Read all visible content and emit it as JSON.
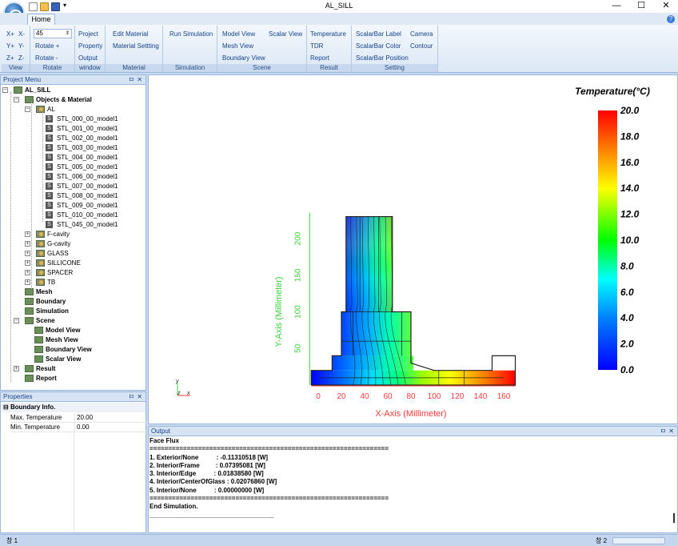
{
  "window": {
    "title": "AL_SILL",
    "minimize": "—",
    "maximize": "☐",
    "close": "✕"
  },
  "ribbon": {
    "tab": "Home",
    "view": {
      "label": "View",
      "buttons": [
        "X+",
        "X-",
        "Y+",
        "Y-",
        "Z+",
        "Z-"
      ]
    },
    "rotate": {
      "label": "Rotate",
      "value": "45",
      "plus": "Rotate +",
      "minus": "Rotate -"
    },
    "window": {
      "label": "window",
      "buttons": [
        "Project",
        "Property",
        "Output"
      ]
    },
    "material": {
      "label": "Material",
      "buttons": [
        "Edit Material",
        "Material Settting"
      ]
    },
    "simulation": {
      "label": "Simulation",
      "buttons": [
        "Run Simulation"
      ]
    },
    "scene": {
      "label": "Scene",
      "buttons": [
        "Model View",
        "Scalar View",
        "Mesh View",
        "Boundary View"
      ]
    },
    "result": {
      "label": "Result",
      "buttons": [
        "Temperature",
        "TDR",
        "Report"
      ]
    },
    "setting": {
      "label": "Setting",
      "buttons": [
        "ScalarBar Label",
        "ScalarBar Color",
        "ScalarBar Position",
        "Camera",
        "Contour"
      ]
    }
  },
  "project_menu": {
    "title": "Project Menu",
    "pin": "ㅁ",
    "close": "✕",
    "root": "AL_SILL",
    "objects": "Objects & Material",
    "al": "AL",
    "al_items": [
      "STL_000_00_model1",
      "STL_001_00_model1",
      "STL_002_00_model1",
      "STL_003_00_model1",
      "STL_004_00_model1",
      "STL_005_00_model1",
      "STL_006_00_model1",
      "STL_007_00_model1",
      "STL_008_00_model1",
      "STL_009_00_model1",
      "STL_010_00_model1",
      "STL_045_00_model1"
    ],
    "materials": [
      "F-cavity",
      "G-cavity",
      "GLASS",
      "SILLICONE",
      "SPACER",
      "TB"
    ],
    "mesh": "Mesh",
    "boundary": "Boundary",
    "simulation": "Simulation",
    "scene": "Scene",
    "scene_items": [
      "Model View",
      "Mesh View",
      "Boundary View",
      "Scalar View"
    ],
    "result": "Result",
    "report": "Report"
  },
  "properties": {
    "title": "Properties",
    "section": "Boundary Info.",
    "rows": [
      {
        "name": "Max. Temperature",
        "value": "20.00"
      },
      {
        "name": "Min. Temperature",
        "value": "0.00"
      }
    ]
  },
  "chart_data": {
    "type": "heatmap",
    "title": "Temperature(°C)",
    "xlabel": "X-Axis (Millimeter)",
    "ylabel": "Y-Axis (Millimeter)",
    "x_ticks": [
      0,
      20,
      40,
      60,
      80,
      100,
      120,
      140,
      160
    ],
    "y_ticks": [
      50,
      100,
      150,
      200
    ],
    "colorbar": {
      "min": 0.0,
      "max": 20.0,
      "ticks": [
        "20.0",
        "18.0",
        "16.0",
        "14.0",
        "12.0",
        "10.0",
        "8.0",
        "6.0",
        "4.0",
        "2.0",
        "0.0"
      ]
    },
    "axis_triad": {
      "y": "y",
      "z": "z",
      "x": "x"
    },
    "colors": {
      "xaxis": "#ff3a3a",
      "yaxis": "#3ad23a",
      "cold": "#0000ff",
      "hot": "#ff0000"
    }
  },
  "output": {
    "title": "Output",
    "lines": [
      "Face Flux",
      "================================================================",
      "1. Exterior/None          : -0.11310518 [W]",
      "2. Interior/Frame         : 0.07395081 [W]",
      "3. Interior/Edge          : 0.01838580 [W]",
      "4. Interior/CenterOfGlass : 0.02076860 [W]",
      "5. Interior/None          : 0.00000000 [W]",
      "================================================================",
      "End Simulation.",
      "___________________________________"
    ]
  },
  "status": {
    "left": "창 1",
    "right": "창 2"
  }
}
